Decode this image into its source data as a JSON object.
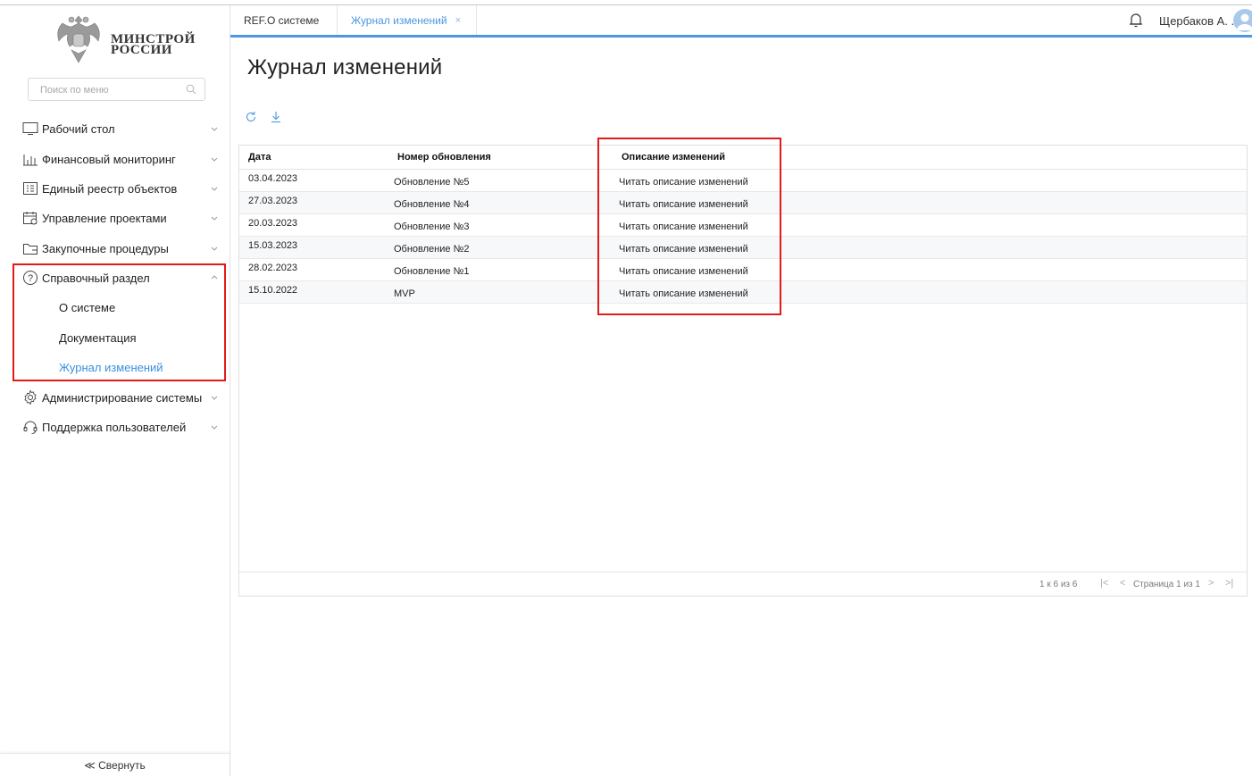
{
  "logo": {
    "line1": "МИНСТРОЙ",
    "line2": "РОССИИ"
  },
  "search": {
    "placeholder": "Поиск по меню"
  },
  "sidebar": {
    "items": [
      {
        "label": "Рабочий стол",
        "icon": "desktop-icon"
      },
      {
        "label": "Финансовый мониторинг",
        "icon": "bar-chart-icon"
      },
      {
        "label": "Единый реестр объектов",
        "icon": "registry-icon"
      },
      {
        "label": "Управление проектами",
        "icon": "calendar-icon"
      },
      {
        "label": "Закупочные процедуры",
        "icon": "folder-icon"
      },
      {
        "label": "Справочный раздел",
        "icon": "help-icon",
        "expanded": true,
        "children": [
          {
            "label": "О системе"
          },
          {
            "label": "Документация"
          },
          {
            "label": "Журнал изменений",
            "active": true
          }
        ]
      },
      {
        "label": "Администрирование системы",
        "icon": "gear-icon"
      },
      {
        "label": "Поддержка пользователей",
        "icon": "headset-icon"
      }
    ],
    "collapse_label": "≪ Свернуть"
  },
  "tabs": [
    {
      "label": "REF.О системе"
    },
    {
      "label": "Журнал изменений",
      "active": true,
      "close": "×"
    }
  ],
  "user": {
    "name": "Щербаков А. ..."
  },
  "page": {
    "title": "Журнал изменений"
  },
  "table": {
    "headers": {
      "date": "Дата",
      "update": "Номер обновления",
      "description": "Описание изменений"
    },
    "rows": [
      {
        "date": "03.04.2023",
        "update": "Обновление №5",
        "description": "Читать описание изменений"
      },
      {
        "date": "27.03.2023",
        "update": "Обновление №4",
        "description": "Читать описание изменений"
      },
      {
        "date": "20.03.2023",
        "update": "Обновление №3",
        "description": "Читать описание изменений"
      },
      {
        "date": "15.03.2023",
        "update": "Обновление №2",
        "description": "Читать описание изменений"
      },
      {
        "date": "28.02.2023",
        "update": "Обновление №1",
        "description": "Читать описание изменений"
      },
      {
        "date": "15.10.2022",
        "update": "MVP",
        "description": "Читать описание изменений"
      }
    ],
    "footer": {
      "range": "1 к 6 из 6",
      "first": "|<",
      "prev": "<",
      "page": "Страница 1 из 1",
      "next": ">",
      "last": ">|"
    }
  },
  "colors": {
    "accent": "#4a98e0",
    "highlight": "#e21a1a"
  }
}
